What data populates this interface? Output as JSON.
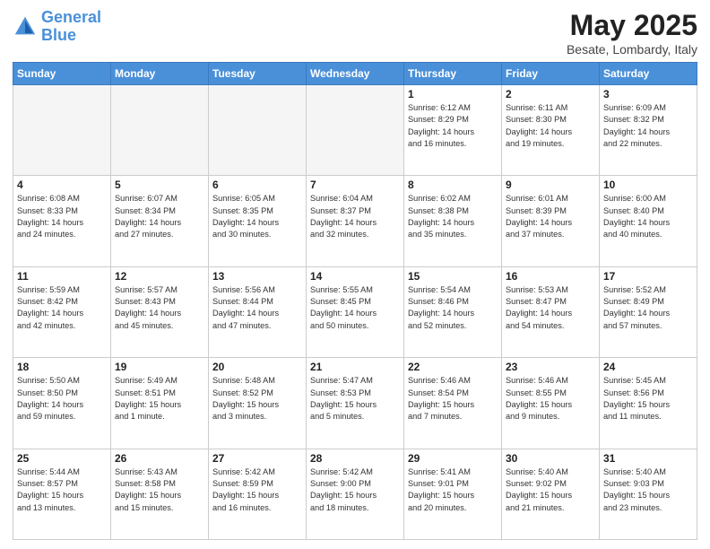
{
  "logo": {
    "line1": "General",
    "line2": "Blue"
  },
  "title": "May 2025",
  "location": "Besate, Lombardy, Italy",
  "weekdays": [
    "Sunday",
    "Monday",
    "Tuesday",
    "Wednesday",
    "Thursday",
    "Friday",
    "Saturday"
  ],
  "weeks": [
    [
      {
        "day": "",
        "info": ""
      },
      {
        "day": "",
        "info": ""
      },
      {
        "day": "",
        "info": ""
      },
      {
        "day": "",
        "info": ""
      },
      {
        "day": "1",
        "info": "Sunrise: 6:12 AM\nSunset: 8:29 PM\nDaylight: 14 hours\nand 16 minutes."
      },
      {
        "day": "2",
        "info": "Sunrise: 6:11 AM\nSunset: 8:30 PM\nDaylight: 14 hours\nand 19 minutes."
      },
      {
        "day": "3",
        "info": "Sunrise: 6:09 AM\nSunset: 8:32 PM\nDaylight: 14 hours\nand 22 minutes."
      }
    ],
    [
      {
        "day": "4",
        "info": "Sunrise: 6:08 AM\nSunset: 8:33 PM\nDaylight: 14 hours\nand 24 minutes."
      },
      {
        "day": "5",
        "info": "Sunrise: 6:07 AM\nSunset: 8:34 PM\nDaylight: 14 hours\nand 27 minutes."
      },
      {
        "day": "6",
        "info": "Sunrise: 6:05 AM\nSunset: 8:35 PM\nDaylight: 14 hours\nand 30 minutes."
      },
      {
        "day": "7",
        "info": "Sunrise: 6:04 AM\nSunset: 8:37 PM\nDaylight: 14 hours\nand 32 minutes."
      },
      {
        "day": "8",
        "info": "Sunrise: 6:02 AM\nSunset: 8:38 PM\nDaylight: 14 hours\nand 35 minutes."
      },
      {
        "day": "9",
        "info": "Sunrise: 6:01 AM\nSunset: 8:39 PM\nDaylight: 14 hours\nand 37 minutes."
      },
      {
        "day": "10",
        "info": "Sunrise: 6:00 AM\nSunset: 8:40 PM\nDaylight: 14 hours\nand 40 minutes."
      }
    ],
    [
      {
        "day": "11",
        "info": "Sunrise: 5:59 AM\nSunset: 8:42 PM\nDaylight: 14 hours\nand 42 minutes."
      },
      {
        "day": "12",
        "info": "Sunrise: 5:57 AM\nSunset: 8:43 PM\nDaylight: 14 hours\nand 45 minutes."
      },
      {
        "day": "13",
        "info": "Sunrise: 5:56 AM\nSunset: 8:44 PM\nDaylight: 14 hours\nand 47 minutes."
      },
      {
        "day": "14",
        "info": "Sunrise: 5:55 AM\nSunset: 8:45 PM\nDaylight: 14 hours\nand 50 minutes."
      },
      {
        "day": "15",
        "info": "Sunrise: 5:54 AM\nSunset: 8:46 PM\nDaylight: 14 hours\nand 52 minutes."
      },
      {
        "day": "16",
        "info": "Sunrise: 5:53 AM\nSunset: 8:47 PM\nDaylight: 14 hours\nand 54 minutes."
      },
      {
        "day": "17",
        "info": "Sunrise: 5:52 AM\nSunset: 8:49 PM\nDaylight: 14 hours\nand 57 minutes."
      }
    ],
    [
      {
        "day": "18",
        "info": "Sunrise: 5:50 AM\nSunset: 8:50 PM\nDaylight: 14 hours\nand 59 minutes."
      },
      {
        "day": "19",
        "info": "Sunrise: 5:49 AM\nSunset: 8:51 PM\nDaylight: 15 hours\nand 1 minute."
      },
      {
        "day": "20",
        "info": "Sunrise: 5:48 AM\nSunset: 8:52 PM\nDaylight: 15 hours\nand 3 minutes."
      },
      {
        "day": "21",
        "info": "Sunrise: 5:47 AM\nSunset: 8:53 PM\nDaylight: 15 hours\nand 5 minutes."
      },
      {
        "day": "22",
        "info": "Sunrise: 5:46 AM\nSunset: 8:54 PM\nDaylight: 15 hours\nand 7 minutes."
      },
      {
        "day": "23",
        "info": "Sunrise: 5:46 AM\nSunset: 8:55 PM\nDaylight: 15 hours\nand 9 minutes."
      },
      {
        "day": "24",
        "info": "Sunrise: 5:45 AM\nSunset: 8:56 PM\nDaylight: 15 hours\nand 11 minutes."
      }
    ],
    [
      {
        "day": "25",
        "info": "Sunrise: 5:44 AM\nSunset: 8:57 PM\nDaylight: 15 hours\nand 13 minutes."
      },
      {
        "day": "26",
        "info": "Sunrise: 5:43 AM\nSunset: 8:58 PM\nDaylight: 15 hours\nand 15 minutes."
      },
      {
        "day": "27",
        "info": "Sunrise: 5:42 AM\nSunset: 8:59 PM\nDaylight: 15 hours\nand 16 minutes."
      },
      {
        "day": "28",
        "info": "Sunrise: 5:42 AM\nSunset: 9:00 PM\nDaylight: 15 hours\nand 18 minutes."
      },
      {
        "day": "29",
        "info": "Sunrise: 5:41 AM\nSunset: 9:01 PM\nDaylight: 15 hours\nand 20 minutes."
      },
      {
        "day": "30",
        "info": "Sunrise: 5:40 AM\nSunset: 9:02 PM\nDaylight: 15 hours\nand 21 minutes."
      },
      {
        "day": "31",
        "info": "Sunrise: 5:40 AM\nSunset: 9:03 PM\nDaylight: 15 hours\nand 23 minutes."
      }
    ]
  ]
}
